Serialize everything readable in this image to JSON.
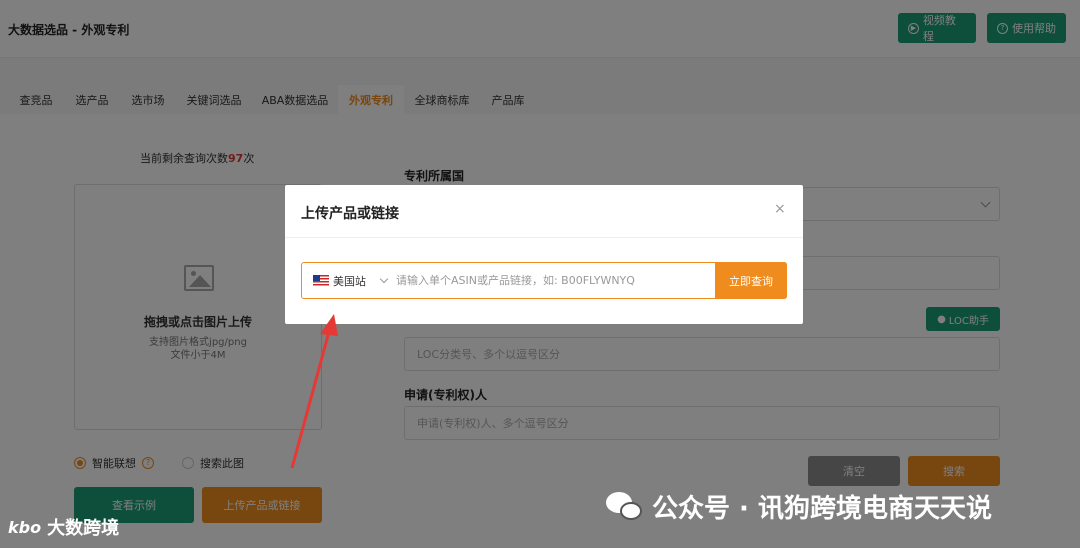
{
  "app": {
    "title": "大数据选品 - 外观专利"
  },
  "header": {
    "video_btn": "视频教程",
    "help_btn": "使用帮助"
  },
  "tabs": [
    {
      "label": "查竞品"
    },
    {
      "label": "选产品"
    },
    {
      "label": "选市场"
    },
    {
      "label": "关键词选品"
    },
    {
      "label": "ABA数据选品"
    },
    {
      "label": "外观专利",
      "active": true
    },
    {
      "label": "全球商标库"
    },
    {
      "label": "产品库"
    }
  ],
  "left_panel": {
    "remaining_prefix": "当前剩余查询次数",
    "remaining_count": "97",
    "remaining_suffix": "次",
    "upload_title": "拖拽或点击图片上传",
    "upload_format": "支持图片格式jpg/png",
    "upload_size": "文件小于4M",
    "radio_smart": "智能联想",
    "radio_search_image": "搜索此图",
    "btn_example": "查看示例",
    "btn_upload_link": "上传产品或链接"
  },
  "right_panel": {
    "country_label": "专利所属国",
    "loc_btn": "LOC助手",
    "loc_placeholder": "LOC分类号、多个以逗号区分",
    "applicant_label": "申请(专利权)人",
    "applicant_placeholder": "申请(专利权)人、多个逗号区分",
    "btn_clear": "清空",
    "btn_search": "搜索"
  },
  "modal": {
    "title": "上传产品或链接",
    "close": "×",
    "station": "美国站",
    "input_placeholder": "请输入单个ASIN或产品链接，如: B00FLYWNYQ",
    "query_btn": "立即查询"
  },
  "watermark": {
    "right_text": "公众号 · 讯狗跨境电商天天说",
    "left_logo": "kbo",
    "left_text": "大数跨境"
  },
  "colors": {
    "accent_orange": "#f08c1e",
    "accent_green": "#1c9e77",
    "annotation_red": "#e53935"
  }
}
